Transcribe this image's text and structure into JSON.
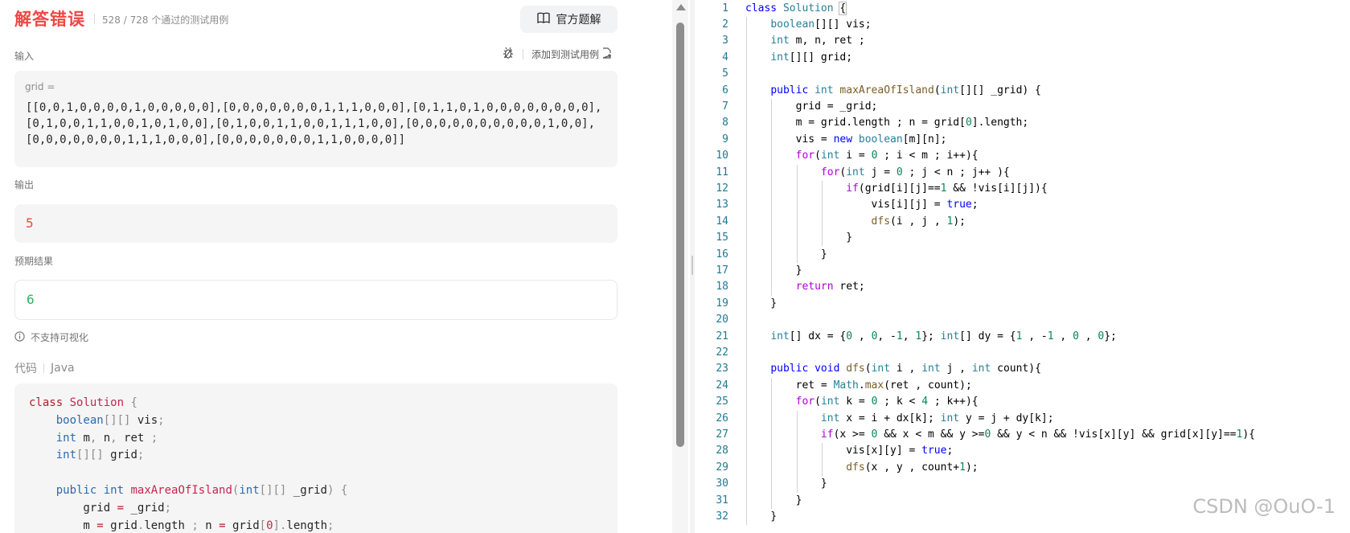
{
  "result": {
    "status": "解答错误",
    "passed_text": "528 / 728 个通过的测试用例",
    "solution_button": "官方题解"
  },
  "input": {
    "label": "输入",
    "add_testcase": "添加到测试用例",
    "var_name": "grid =",
    "value": "[[0,0,1,0,0,0,0,1,0,0,0,0,0],[0,0,0,0,0,0,0,1,1,1,0,0,0],[0,1,1,0,1,0,0,0,0,0,0,0,0],[0,1,0,0,1,1,0,0,1,0,1,0,0],[0,1,0,0,1,1,0,0,1,1,1,0,0],[0,0,0,0,0,0,0,0,0,0,1,0,0],[0,0,0,0,0,0,0,1,1,1,0,0,0],[0,0,0,0,0,0,0,1,1,0,0,0,0]]"
  },
  "output": {
    "label": "输出",
    "value": "5"
  },
  "expected": {
    "label": "预期结果",
    "value": "6"
  },
  "visualization_note": "不支持可视化",
  "code_section": {
    "label": "代码",
    "language": "Java"
  },
  "code_preview": [
    "class Solution {",
    "    boolean[][] vis;",
    "    int m, n, ret ;",
    "    int[][] grid;",
    "",
    "    public int maxAreaOfIsland(int[][] _grid) {",
    "        grid = _grid;",
    "        m = grid.length ; n = grid[0].length;"
  ],
  "editor": {
    "lines": [
      "class Solution {",
      "    boolean[][] vis;",
      "    int m, n, ret ;",
      "    int[][] grid;",
      "",
      "    public int maxAreaOfIsland(int[][] _grid) {",
      "        grid = _grid;",
      "        m = grid.length ; n = grid[0].length;",
      "        vis = new boolean[m][n];",
      "        for(int i = 0 ; i < m ; i++){",
      "            for(int j = 0 ; j < n ; j++ ){",
      "                if(grid[i][j]==1 && !vis[i][j]){",
      "                    vis[i][j] = true;",
      "                    dfs(i , j , 1);",
      "                }",
      "            }",
      "        }",
      "        return ret;",
      "    }",
      "",
      "    int[] dx = {0 , 0, -1, 1}; int[] dy = {1 , -1 , 0 , 0};",
      "",
      "    public void dfs(int i , int j , int count){",
      "        ret = Math.max(ret , count);",
      "        for(int k = 0 ; k < 4 ; k++){",
      "            int x = i + dx[k]; int y = j + dy[k];",
      "            if(x >= 0 && x < m && y >=0 && y < n && !vis[x][y] && grid[x][y]==1){",
      "                vis[x][y] = true;",
      "                dfs(x , y , count+1);",
      "            }",
      "        }",
      "    }"
    ]
  },
  "watermark": "CSDN @OuO-1",
  "colors": {
    "error": "#ef4743",
    "expected": "#2db55d",
    "keyword": "#0000ff",
    "control": "#af00db",
    "type": "#267f99",
    "function": "#795e26",
    "number": "#098658",
    "line_number": "#237893"
  }
}
